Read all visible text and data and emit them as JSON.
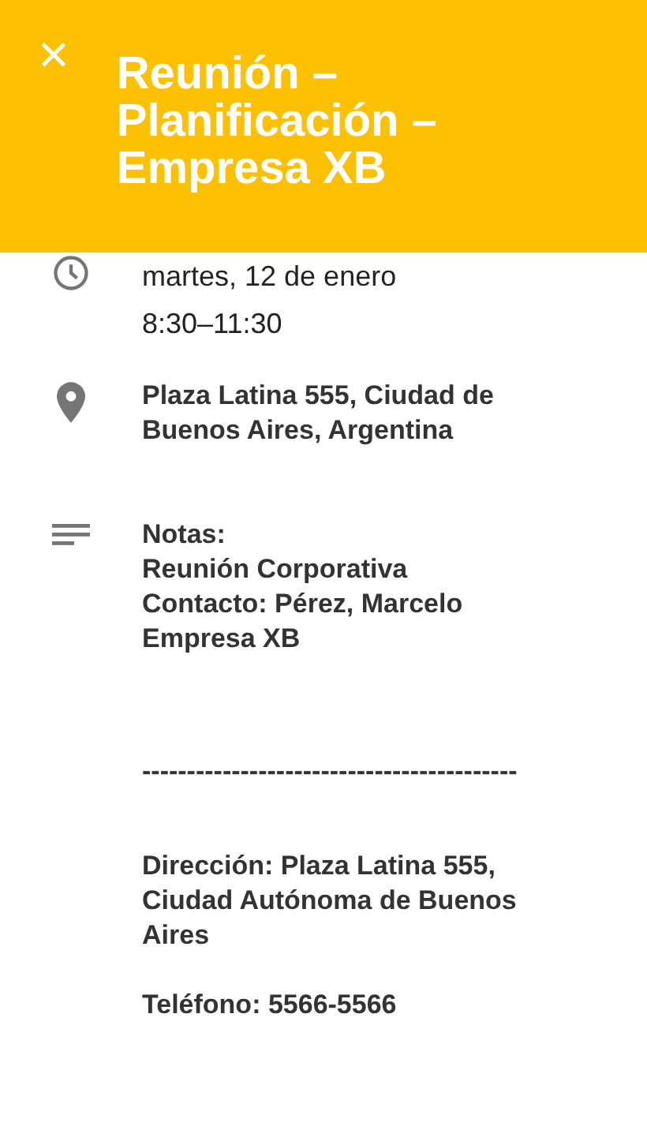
{
  "header": {
    "close": "×",
    "title": "Reunión – Planificación – Empresa XB"
  },
  "sections": [
    {
      "kind": "time",
      "lines": [
        "martes, 12 de enero",
        "8:30–11:30"
      ]
    },
    {
      "kind": "location",
      "lines": [
        "Plaza Latina 555, Ciudad de Buenos Aires, Argentina"
      ]
    },
    {
      "kind": "notes",
      "paragraphs": [
        {
          "kind": "text",
          "lines": [
            "Notas:",
            "Reunión Corporativa",
            "Contacto: Pérez, Marcelo",
            "Empresa XB"
          ]
        },
        {
          "kind": "rule",
          "lines": [
            "------------------------------------------"
          ]
        },
        {
          "kind": "text",
          "lines": [
            "Dirección: Plaza Latina 555, Ciudad Autónoma de Buenos Aires"
          ]
        },
        {
          "kind": "text",
          "lines": [
            "Teléfono: 5566-5566"
          ]
        }
      ]
    }
  ]
}
